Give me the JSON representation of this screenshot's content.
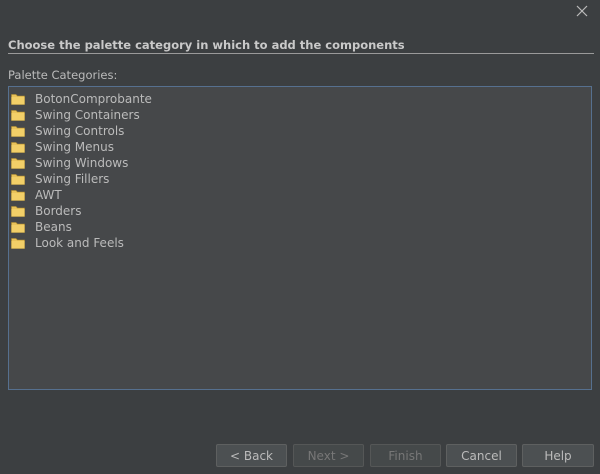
{
  "dialog": {
    "heading": "Choose the palette category in which to add the components",
    "list_label": "Palette Categories:"
  },
  "categories": [
    {
      "label": "BotonComprobante",
      "icon": "folder-icon"
    },
    {
      "label": "Swing Containers",
      "icon": "folder-icon"
    },
    {
      "label": "Swing Controls",
      "icon": "folder-icon"
    },
    {
      "label": "Swing Menus",
      "icon": "folder-icon"
    },
    {
      "label": "Swing Windows",
      "icon": "folder-icon"
    },
    {
      "label": "Swing Fillers",
      "icon": "folder-icon"
    },
    {
      "label": "AWT",
      "icon": "folder-icon"
    },
    {
      "label": "Borders",
      "icon": "folder-icon"
    },
    {
      "label": "Beans",
      "icon": "folder-icon"
    },
    {
      "label": "Look and Feels",
      "icon": "folder-icon"
    }
  ],
  "buttons": {
    "back": "< Back",
    "next": "Next >",
    "finish": "Finish",
    "cancel": "Cancel",
    "help": "Help"
  },
  "colors": {
    "background": "#3c3f41",
    "list_background": "#46484a",
    "list_border": "#56708f",
    "folder": "#e8c25a"
  }
}
